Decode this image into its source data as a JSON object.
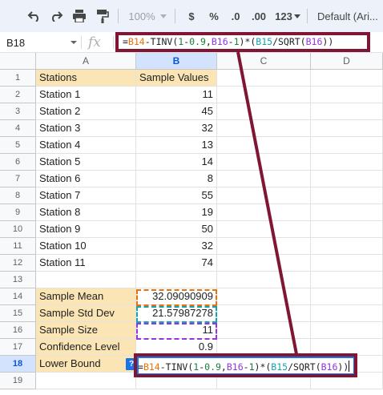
{
  "toolbar": {
    "zoom": "100%",
    "currency": "$",
    "percent": "%",
    "decrease_decimals": ".0",
    "increase_decimals": ".00",
    "more_formats": "123",
    "font": "Default (Ari..."
  },
  "formula_bar": {
    "name_box": "B18",
    "fx": "fx",
    "formula_parts": [
      "=",
      "B14",
      "-TINV(",
      "1",
      "-",
      "0.9",
      ",",
      "B16",
      "-",
      "1",
      ")*(",
      "B15",
      "/SQRT(",
      "B16",
      "))"
    ]
  },
  "columns": [
    "A",
    "B",
    "C",
    "D"
  ],
  "rows": [
    "1",
    "2",
    "3",
    "4",
    "5",
    "6",
    "7",
    "8",
    "9",
    "10",
    "11",
    "12",
    "13",
    "14",
    "15",
    "16",
    "17",
    "18",
    "19"
  ],
  "sheet": {
    "header_a": "Stations",
    "header_b": "Sample Values",
    "stations": [
      {
        "name": "Station 1",
        "value": "11"
      },
      {
        "name": "Station 2",
        "value": "45"
      },
      {
        "name": "Station 3",
        "value": "32"
      },
      {
        "name": "Station 4",
        "value": "13"
      },
      {
        "name": "Station 5",
        "value": "14"
      },
      {
        "name": "Station 6",
        "value": "8"
      },
      {
        "name": "Station 7",
        "value": "55"
      },
      {
        "name": "Station 8",
        "value": "19"
      },
      {
        "name": "Station 9",
        "value": "50"
      },
      {
        "name": "Station 10",
        "value": "32"
      },
      {
        "name": "Station 11",
        "value": "74"
      }
    ],
    "stats": [
      {
        "label": "Sample Mean",
        "value": "32.09090909"
      },
      {
        "label": "Sample Std Dev",
        "value": "21.57987278"
      },
      {
        "label": "Sample Size",
        "value": "11"
      },
      {
        "label": "Confidence Level",
        "value": "0.9"
      },
      {
        "label": "Lower Bound",
        "value": ""
      }
    ]
  },
  "editor": {
    "help": "?",
    "formula_parts": [
      "=",
      "B14",
      "-TINV(",
      "1",
      "-",
      "0.9",
      ",",
      "B16",
      "-",
      "1",
      ")*(",
      "B15",
      "/SQRT(",
      "B16",
      "))"
    ]
  },
  "colors": {
    "highlight_fill": "#fce5b4",
    "annotation": "#7f1734",
    "ref_b14": "#e8710a",
    "ref_b15": "#12a4af",
    "ref_b16": "#9334e6",
    "selection": "#1a73e8"
  }
}
